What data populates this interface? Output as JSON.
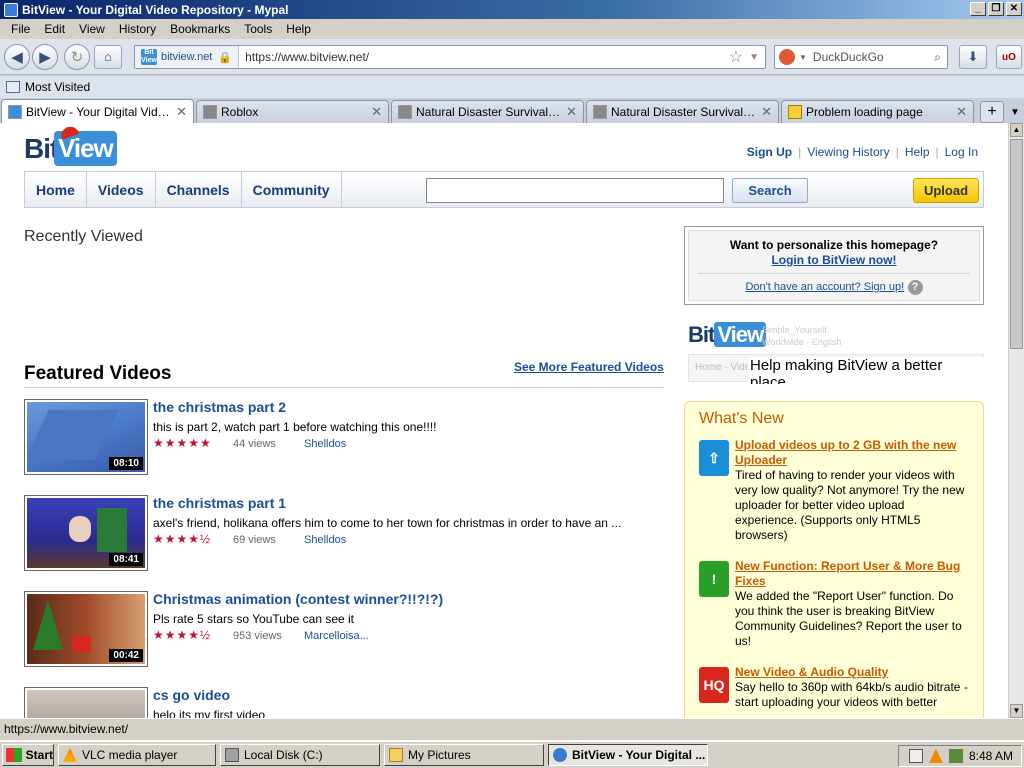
{
  "window": {
    "title": "BitView - Your Digital Video Repository - Mypal"
  },
  "menu": [
    "File",
    "Edit",
    "View",
    "History",
    "Bookmarks",
    "Tools",
    "Help"
  ],
  "nav": {
    "identity": "bitview.net",
    "url": "https://www.bitview.net/",
    "search_placeholder": "DuckDuckGo"
  },
  "bookmarks": {
    "most_visited": "Most Visited"
  },
  "tabs": [
    {
      "label": "BitView - Your Digital Video R...",
      "active": true
    },
    {
      "label": "Roblox",
      "active": false
    },
    {
      "label": "Natural Disaster Survival Gue...",
      "active": false
    },
    {
      "label": "Natural Disaster Survival Gue...",
      "active": false
    },
    {
      "label": "Problem loading page",
      "active": false
    }
  ],
  "page": {
    "logo": {
      "bit": "Bit",
      "view": "View"
    },
    "toplinks": {
      "signup": "Sign Up",
      "history": "Viewing History",
      "help": "Help",
      "login": "Log In"
    },
    "navmenu": [
      "Home",
      "Videos",
      "Channels",
      "Community"
    ],
    "search_button": "Search",
    "upload_button": "Upload",
    "recently_viewed": "Recently Viewed",
    "featured_title": "Featured Videos",
    "see_more": "See More Featured Videos",
    "videos": [
      {
        "title": "the christmas part 2",
        "desc": "this is part 2, watch part 1 before watching this one!!!!",
        "stars": "★★★★★",
        "views": "44 views",
        "user": "Shelldos",
        "duration": "08:10"
      },
      {
        "title": "the christmas part 1",
        "desc": "axel's friend, holikana offers him to come to her town for christmas in order to have an ...",
        "stars": "★★★★½",
        "views": "69 views",
        "user": "Shelldos",
        "duration": "08:41"
      },
      {
        "title": "Christmas animation (contest winner?!!?!?)",
        "desc": "Pls rate 5 stars so YouTube can see it",
        "stars": "★★★★½",
        "views": "953 views",
        "user": "Marcelloisa...",
        "duration": "00:42"
      },
      {
        "title": "cs go video",
        "desc": "helo its my first video",
        "stars": "",
        "views": "",
        "user": "",
        "duration": ""
      }
    ],
    "login_box": {
      "line1": "Want to personalize this homepage?",
      "line2": "Login to BitView now!",
      "line3": "Don't have an account? Sign up!"
    },
    "promo": {
      "logo_bit": "Bit",
      "logo_view": "View",
      "faded1": "Simple_Yourself",
      "faded2": "Worldwide · English",
      "nav": "Home · Videos · Channels · Community",
      "text": "Help making BitView a better place."
    },
    "whats_new": {
      "title": "What's New",
      "items": [
        {
          "icon": "upload-icon",
          "icon_color": "#1a8fd8",
          "head": "Upload videos up to 2 GB with the new Uploader",
          "body": "Tired of having to render your videos with very low quality? Not anymore! Try the new uploader for better video upload experience. (Supports only HTML5 browsers)"
        },
        {
          "icon": "warning-icon",
          "icon_color": "#2aa02a",
          "head": "New Function: Report User & More Bug Fixes",
          "body": "We added the \"Report User\" function. Do you think the user is breaking BitView Community Guidelines? Report the user to us!"
        },
        {
          "icon": "hq-icon",
          "icon_color": "#d8281e",
          "head": "New Video & Audio Quality",
          "body": "Say hello to 360p with 64kb/s audio bitrate - start uploading your videos with better"
        }
      ]
    }
  },
  "status": {
    "text": "https://www.bitview.net/"
  },
  "taskbar": {
    "start": "Start",
    "tasks": [
      "VLC media player",
      "Local Disk (C:)",
      "My Pictures",
      "BitView - Your Digital ..."
    ],
    "clock": "8:48 AM"
  }
}
